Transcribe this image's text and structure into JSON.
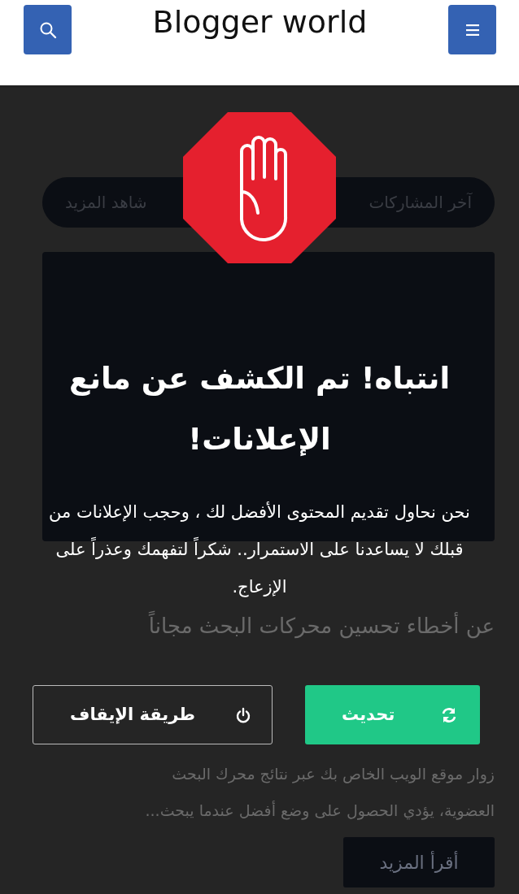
{
  "header": {
    "title": "Blogger world"
  },
  "tabs": [
    {
      "label": "آخر المشاركات"
    },
    {
      "label": "شاهد المزيد"
    }
  ],
  "post": {
    "title_lines": [
      "عن أخطاء تحسين محركات البحث مجاناً"
    ],
    "excerpt_lines": [
      "زوار موقع الويب الخاص بك عبر نتائج محرك البحث",
      "العضوية، يؤدي الحصول على وضع أفضل عندما يبحث..."
    ],
    "read_more": "أقرأ المزيد"
  },
  "alert": {
    "title": "انتباه! تم الكشف عن مانع الإعلانات!",
    "message": "نحن نحاول تقديم المحتوى الأفضل لك ، وحجب الإعلانات من قبلك لا يساعدنا على الاستمرار.. شكراً لتفهمك وعذراً على الإزعاج.",
    "buttons": [
      {
        "label": "تحديث",
        "kind": "refresh"
      },
      {
        "label": "طريقة الإيقاف",
        "kind": "power"
      }
    ]
  }
}
